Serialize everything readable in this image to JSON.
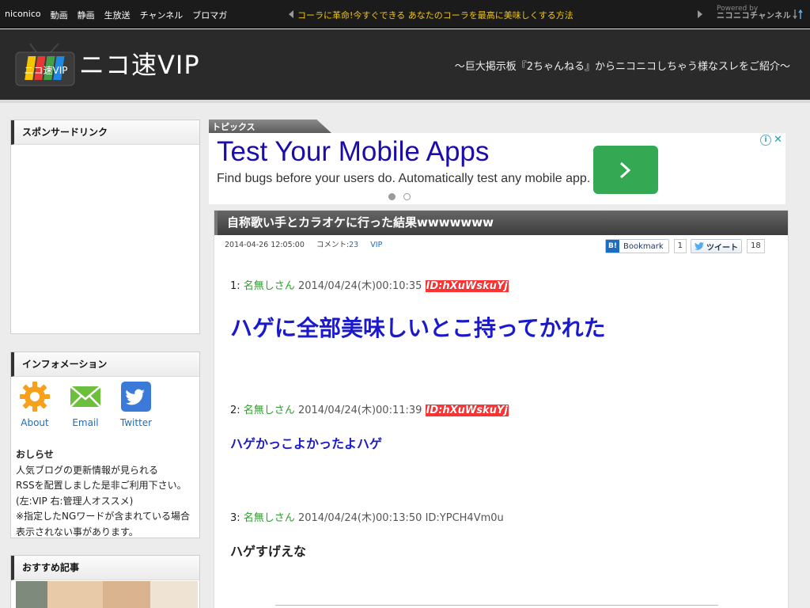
{
  "topbar": {
    "nav": [
      "niconico",
      "動画",
      "静画",
      "生放送",
      "チャンネル",
      "ブロマガ"
    ],
    "news": "コーラに革命!今すぐできる あなたのコーラを最高に美味しくする方法",
    "powered_by": "Powered by",
    "powered_name": "ニコニコチャンネル"
  },
  "header": {
    "tagline": "～巨大掲示板『2ちゃんねる』からニコニコしちゃう様なスレをご紹介～"
  },
  "sidebar": {
    "sponsor_title": "スポンサードリンク",
    "info_title": "インフォメーション",
    "info_icons": [
      {
        "label": "About",
        "icon": "gear-icon"
      },
      {
        "label": "Email",
        "icon": "envelope-icon"
      },
      {
        "label": "Twitter",
        "icon": "twitter-icon"
      }
    ],
    "notice_heading": "おしらせ",
    "notice_lines": [
      "人気ブログの更新情報が見られる",
      "RSSを配置しました是非ご利用下さい。",
      "(左:VIP 右:管理人オススメ)",
      "※指定したNGワードが含まれている場合",
      "表示されない事があります。"
    ],
    "recommend_title": "おすすめ記事"
  },
  "topics": {
    "tab_label": "トピックス"
  },
  "ad": {
    "title": "Test Your Mobile Apps",
    "description": "Find bugs before your users do. Automatically test any mobile app.",
    "button_color": "#34a853"
  },
  "article": {
    "title": "自称歌い手とカラオケに行った結果wwwwwww",
    "date": "2014-04-26 12:05:00",
    "comment_label": "コメント:",
    "comment_count": "23",
    "category": "VIP",
    "share": {
      "hatena_label": "Bookmark",
      "hatena_count": "1",
      "tweet_label": "ツイート",
      "tweet_count": "18"
    },
    "posts": [
      {
        "no": "1:",
        "name": "名無しさん",
        "datetime": "2014/04/24(木)00:10:35",
        "id": "ID:hXuWskuYj",
        "body": "ハゲに全部美味しいとこ持ってかれた"
      },
      {
        "no": "2:",
        "name": "名無しさん",
        "datetime": "2014/04/24(木)00:11:39",
        "id": "ID:hXuWskuYj",
        "body": "ハゲかっこよかったよハゲ"
      },
      {
        "no": "3:",
        "name": "名無しさん",
        "datetime": "2014/04/24(木)00:13:50",
        "id": "ID:YPCH4Vm0u",
        "body": "ハゲすげえな"
      }
    ]
  },
  "colors": {
    "topbar_bg": "#1b1b1b",
    "news_text": "#f0c419",
    "header_bg": "#2a2a2a",
    "post_name": "#2a9e2a",
    "post_big_body": "#1a1acc",
    "id_highlight": "#ff3333",
    "link": "#1a6dc2"
  }
}
